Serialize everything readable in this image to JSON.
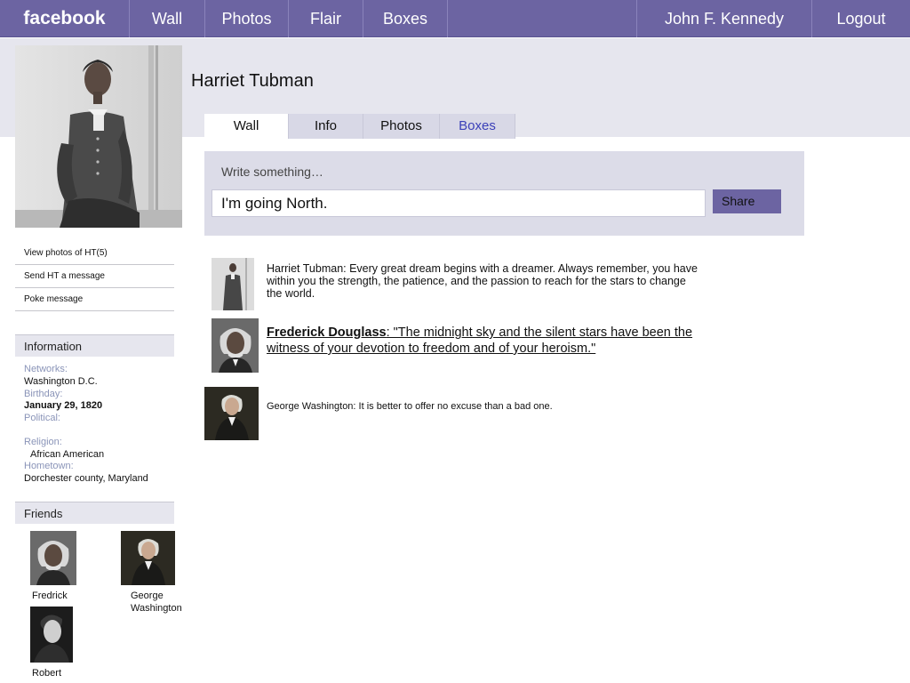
{
  "topbar": {
    "logo": "facebook",
    "nav": [
      "Wall",
      "Photos",
      "Flair",
      "Boxes"
    ],
    "user": "John F. Kennedy",
    "logout": "Logout"
  },
  "profile": {
    "name": "Harriet Tubman",
    "tabs": [
      "Wall",
      "Info",
      "Photos",
      "Boxes"
    ]
  },
  "composer": {
    "prompt": "Write something…",
    "value": "I'm going North.",
    "share_label": "Share"
  },
  "posts": [
    {
      "author": "Harriet Tubman",
      "text": "Harriet Tubman: Every great dream begins with a dreamer. Always remember, you have within you the strength, the patience, and the passion to reach for the stars to change the world."
    },
    {
      "author": "Frederick Douglass",
      "text": ": \"The midnight sky and the silent stars have been the witness of your devotion to freedom and of your heroism.\""
    },
    {
      "author": "George Washington",
      "text": "George Washington: It is better to offer no excuse than a bad one."
    }
  ],
  "sidebar": {
    "links": [
      "View photos of HT(5)",
      "Send HT a message",
      "Poke message"
    ],
    "information_heading": "Information",
    "info": {
      "networks_label": "Networks:",
      "networks_value": "Washington D.C.",
      "birthday_label": "Birthday:",
      "birthday_value": "January 29, 1820",
      "political_label": "Political:",
      "religion_label": "Religion:",
      "religion_value": "African American",
      "hometown_label": "Hometown:",
      "hometown_value": "Dorchester county, Maryland"
    },
    "friends_heading": "Friends",
    "friends": [
      "Fredrick",
      "George Washington",
      "Robert"
    ]
  },
  "colors": {
    "topbar": "#6c64a2",
    "band": "#e6e6ee",
    "link_accent": "#3b40b8",
    "info_label": "#8a94b8"
  }
}
